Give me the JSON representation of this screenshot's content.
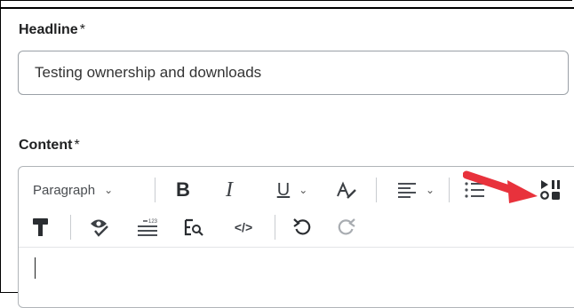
{
  "headline": {
    "label": "Headline",
    "required_marker": "*",
    "value": "Testing ownership and downloads"
  },
  "content": {
    "label": "Content",
    "required_marker": "*"
  },
  "toolbar": {
    "format_select": "Paragraph",
    "bold_label": "B",
    "italic_label": "I",
    "underline_label": "U",
    "code_label": "</>",
    "icons": [
      "chevron-down-icon",
      "bold-icon",
      "italic-icon",
      "underline-icon",
      "text-style-icon",
      "align-icon",
      "list-icon",
      "media-insert-icon",
      "format-painter-icon",
      "accessibility-check-icon",
      "word-count-icon",
      "find-replace-icon",
      "code-view-icon",
      "undo-icon",
      "redo-icon"
    ]
  },
  "annotation": {
    "arrow_color": "#e8323c"
  }
}
